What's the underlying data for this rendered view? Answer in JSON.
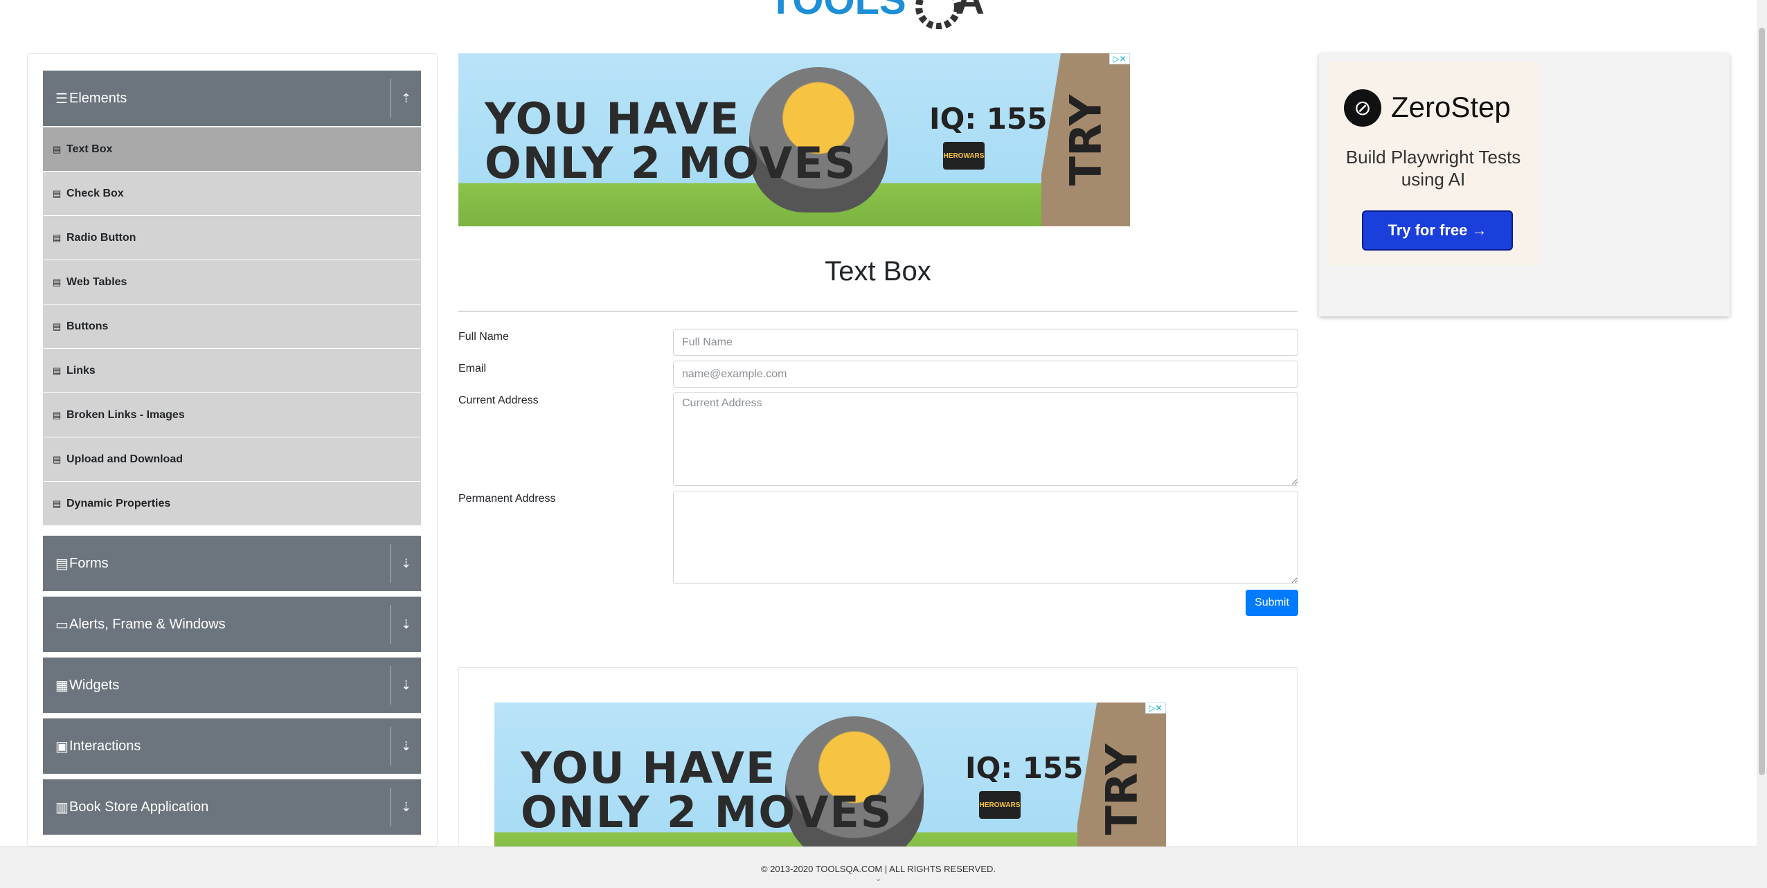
{
  "header": {
    "logo_text": "TOOLSQA"
  },
  "sidebar": {
    "groups": [
      {
        "title": "Elements",
        "icon": "hamburger-icon",
        "expanded": true
      },
      {
        "title": "Forms",
        "icon": "document-icon"
      },
      {
        "title": "Alerts, Frame & Windows",
        "icon": "window-icon"
      },
      {
        "title": "Widgets",
        "icon": "grid-icon"
      },
      {
        "title": "Interactions",
        "icon": "interaction-icon"
      },
      {
        "title": "Book Store Application",
        "icon": "books-icon"
      }
    ],
    "items": [
      {
        "label": "Text Box",
        "active": true
      },
      {
        "label": "Check Box"
      },
      {
        "label": "Radio Button"
      },
      {
        "label": "Web Tables"
      },
      {
        "label": "Buttons"
      },
      {
        "label": "Links"
      },
      {
        "label": "Broken Links - Images"
      },
      {
        "label": "Upload and Download"
      },
      {
        "label": "Dynamic Properties"
      }
    ]
  },
  "ad": {
    "line1": "YOU HAVE",
    "line2": "ONLY 2 MOVES",
    "iq": "IQ: 155",
    "try": "TRY",
    "brand": "HEROWARS",
    "close": "▷✕"
  },
  "main": {
    "title": "Text Box",
    "form": {
      "full_name_label": "Full Name",
      "full_name_placeholder": "Full Name",
      "email_label": "Email",
      "email_placeholder": "name@example.com",
      "current_address_label": "Current Address",
      "current_address_placeholder": "Current Address",
      "permanent_address_label": "Permanent Address",
      "submit_label": "Submit"
    }
  },
  "right_ad": {
    "brand": "ZeroStep",
    "tagline": "Build Playwright Tests using AI",
    "cta": "Try for free →"
  },
  "footer": {
    "text": "© 2013-2020 TOOLSQA.COM | ALL RIGHTS RESERVED."
  }
}
